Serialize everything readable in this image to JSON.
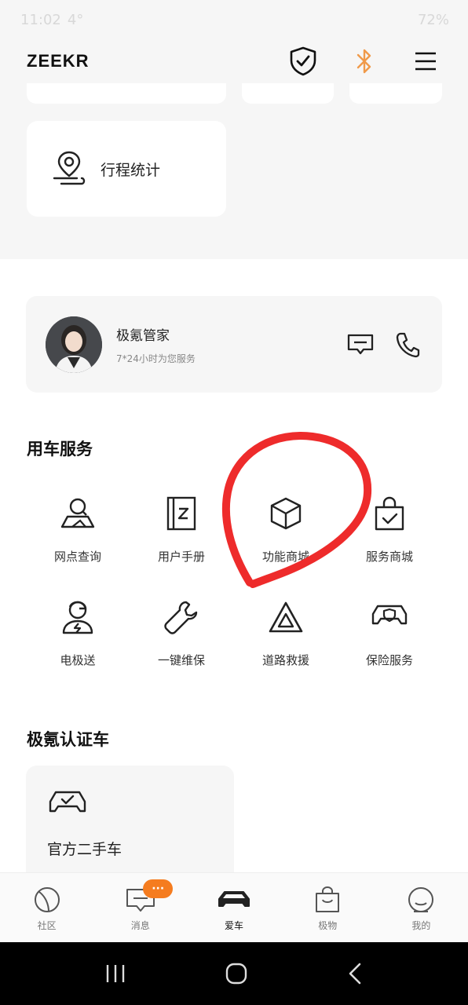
{
  "status_bar": {
    "time": "11:02",
    "temp": "4°",
    "battery": "72%"
  },
  "header": {
    "brand": "ZEEKR",
    "icons": [
      "shield-check-icon",
      "bluetooth-icon",
      "menu-icon"
    ],
    "bluetooth_color": "#f09a4a"
  },
  "top_section": {
    "trip_card_label": "行程统计"
  },
  "concierge": {
    "name": "极氪管家",
    "subtitle": "7*24小时为您服务",
    "icons": [
      "message-icon",
      "phone-icon"
    ]
  },
  "services": {
    "title": "用车服务",
    "items": [
      {
        "label": "网点查询",
        "icon": "location-search-icon"
      },
      {
        "label": "用户手册",
        "icon": "manual-icon"
      },
      {
        "label": "功能商城",
        "icon": "cube-icon"
      },
      {
        "label": "服务商城",
        "icon": "shopping-bag-icon"
      },
      {
        "label": "电极送",
        "icon": "delivery-person-icon"
      },
      {
        "label": "一键维保",
        "icon": "wrench-icon"
      },
      {
        "label": "道路救援",
        "icon": "warning-triangle-icon"
      },
      {
        "label": "保险服务",
        "icon": "insurance-car-icon"
      }
    ]
  },
  "certified": {
    "title": "极氪认证车",
    "card_title": "官方二手车"
  },
  "tab_bar": {
    "badge": "···",
    "tabs": [
      {
        "label": "社区",
        "icon": "community-icon"
      },
      {
        "label": "消息",
        "icon": "message-icon"
      },
      {
        "label": "爱车",
        "icon": "car-icon",
        "active": true
      },
      {
        "label": "极物",
        "icon": "shop-bag-icon"
      },
      {
        "label": "我的",
        "icon": "profile-icon"
      }
    ]
  },
  "annotation_color": "#ee2b2b"
}
